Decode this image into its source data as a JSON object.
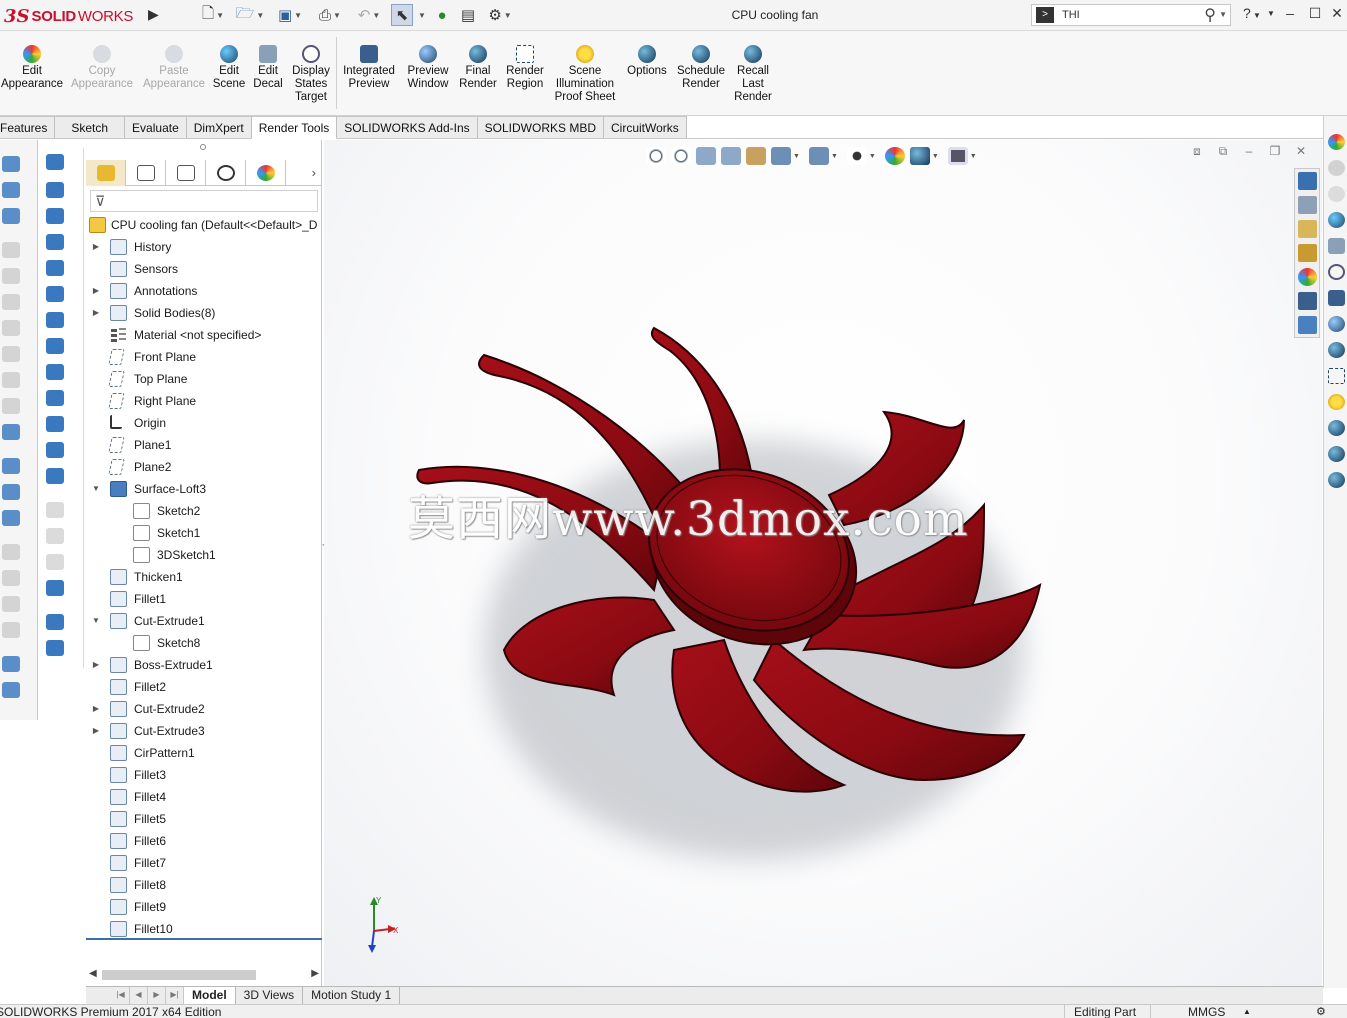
{
  "app": {
    "logo_ds": "3S",
    "logo_solid": "SOLID",
    "logo_works": "WORKS",
    "document_title": "CPU cooling fan",
    "search_value": "THI"
  },
  "ribbon": {
    "buttons": [
      {
        "label": "Edit Appearance",
        "enabled": true,
        "icon": "edit-appearance-icon"
      },
      {
        "label": "Copy Appearance",
        "enabled": false,
        "icon": "copy-appearance-icon"
      },
      {
        "label": "Paste Appearance",
        "enabled": false,
        "icon": "paste-appearance-icon"
      },
      {
        "label": "Edit Scene",
        "enabled": true,
        "icon": "edit-scene-icon"
      },
      {
        "label": "Edit Decal",
        "enabled": true,
        "icon": "edit-decal-icon"
      },
      {
        "label": "Display States Target",
        "enabled": true,
        "icon": "display-states-icon"
      },
      {
        "label": "Integrated Preview",
        "enabled": true,
        "icon": "integrated-preview-icon"
      },
      {
        "label": "Preview Window",
        "enabled": true,
        "icon": "preview-window-icon"
      },
      {
        "label": "Final Render",
        "enabled": true,
        "icon": "final-render-icon"
      },
      {
        "label": "Render Region",
        "enabled": true,
        "icon": "render-region-icon"
      },
      {
        "label": "Scene Illumination Proof Sheet",
        "enabled": true,
        "icon": "scene-illumination-icon"
      },
      {
        "label": "Options",
        "enabled": true,
        "icon": "options-icon"
      },
      {
        "label": "Schedule Render",
        "enabled": true,
        "icon": "schedule-render-icon"
      },
      {
        "label": "Recall Last Render",
        "enabled": true,
        "icon": "recall-render-icon"
      }
    ]
  },
  "command_tabs": [
    "Features",
    "Sketch",
    "Evaluate",
    "DimXpert",
    "Render Tools",
    "SOLIDWORKS Add-Ins",
    "SOLIDWORKS MBD",
    "CircuitWorks"
  ],
  "active_command_tab": "Render Tools",
  "feature_tree": {
    "root": "CPU cooling fan  (Default<<Default>_D",
    "items": [
      {
        "label": "History",
        "expand": true,
        "icon": "history-icon",
        "level": 0
      },
      {
        "label": "Sensors",
        "expand": false,
        "icon": "sensors-icon",
        "level": 0
      },
      {
        "label": "Annotations",
        "expand": true,
        "icon": "annotations-icon",
        "level": 0
      },
      {
        "label": "Solid Bodies(8)",
        "expand": true,
        "icon": "solid-bodies-icon",
        "level": 0
      },
      {
        "label": "Material <not specified>",
        "expand": false,
        "icon": "material-icon",
        "level": 0
      },
      {
        "label": "Front Plane",
        "expand": false,
        "icon": "plane-icon",
        "level": 0
      },
      {
        "label": "Top Plane",
        "expand": false,
        "icon": "plane-icon",
        "level": 0
      },
      {
        "label": "Right Plane",
        "expand": false,
        "icon": "plane-icon",
        "level": 0
      },
      {
        "label": "Origin",
        "expand": false,
        "icon": "origin-icon",
        "level": 0
      },
      {
        "label": "Plane1",
        "expand": false,
        "icon": "plane-icon",
        "level": 0
      },
      {
        "label": "Plane2",
        "expand": false,
        "icon": "plane-icon",
        "level": 0
      },
      {
        "label": "Surface-Loft3",
        "expand": "open",
        "icon": "surface-loft-icon",
        "level": 0
      },
      {
        "label": "Sketch2",
        "expand": false,
        "icon": "sketch-icon",
        "level": 1
      },
      {
        "label": "Sketch1",
        "expand": false,
        "icon": "sketch-icon",
        "level": 1
      },
      {
        "label": "3DSketch1",
        "expand": false,
        "icon": "3d-sketch-icon",
        "level": 1
      },
      {
        "label": "Thicken1",
        "expand": false,
        "icon": "thicken-icon",
        "level": 0
      },
      {
        "label": "Fillet1",
        "expand": false,
        "icon": "fillet-icon",
        "level": 0
      },
      {
        "label": "Cut-Extrude1",
        "expand": "open",
        "icon": "cut-extrude-icon",
        "level": 0
      },
      {
        "label": "Sketch8",
        "expand": false,
        "icon": "sketch-icon",
        "level": 1
      },
      {
        "label": "Boss-Extrude1",
        "expand": true,
        "icon": "boss-extrude-icon",
        "level": 0
      },
      {
        "label": "Fillet2",
        "expand": false,
        "icon": "fillet-icon",
        "level": 0
      },
      {
        "label": "Cut-Extrude2",
        "expand": true,
        "icon": "cut-extrude-icon",
        "level": 0
      },
      {
        "label": "Cut-Extrude3",
        "expand": true,
        "icon": "cut-extrude-icon",
        "level": 0
      },
      {
        "label": "CirPattern1",
        "expand": false,
        "icon": "circular-pattern-icon",
        "level": 0
      },
      {
        "label": "Fillet3",
        "expand": false,
        "icon": "fillet-icon",
        "level": 0
      },
      {
        "label": "Fillet4",
        "expand": false,
        "icon": "fillet-icon",
        "level": 0
      },
      {
        "label": "Fillet5",
        "expand": false,
        "icon": "fillet-icon",
        "level": 0
      },
      {
        "label": "Fillet6",
        "expand": false,
        "icon": "fillet-icon",
        "level": 0
      },
      {
        "label": "Fillet7",
        "expand": false,
        "icon": "fillet-icon",
        "level": 0
      },
      {
        "label": "Fillet8",
        "expand": false,
        "icon": "fillet-icon",
        "level": 0
      },
      {
        "label": "Fillet9",
        "expand": false,
        "icon": "fillet-icon",
        "level": 0
      },
      {
        "label": "Fillet10",
        "expand": false,
        "icon": "fillet-icon",
        "level": 0
      }
    ]
  },
  "viewport": {
    "watermark": "莫西网www.3dmox.com",
    "model_color": "#8b0a12",
    "triad_x_label": "X",
    "triad_y_label": "Y"
  },
  "bottom_tabs": [
    "Model",
    "3D Views",
    "Motion Study 1"
  ],
  "active_bottom_tab": "Model",
  "status": {
    "edition": "SOLIDWORKS Premium 2017 x64 Edition",
    "mode": "Editing Part",
    "units": "MMGS"
  }
}
